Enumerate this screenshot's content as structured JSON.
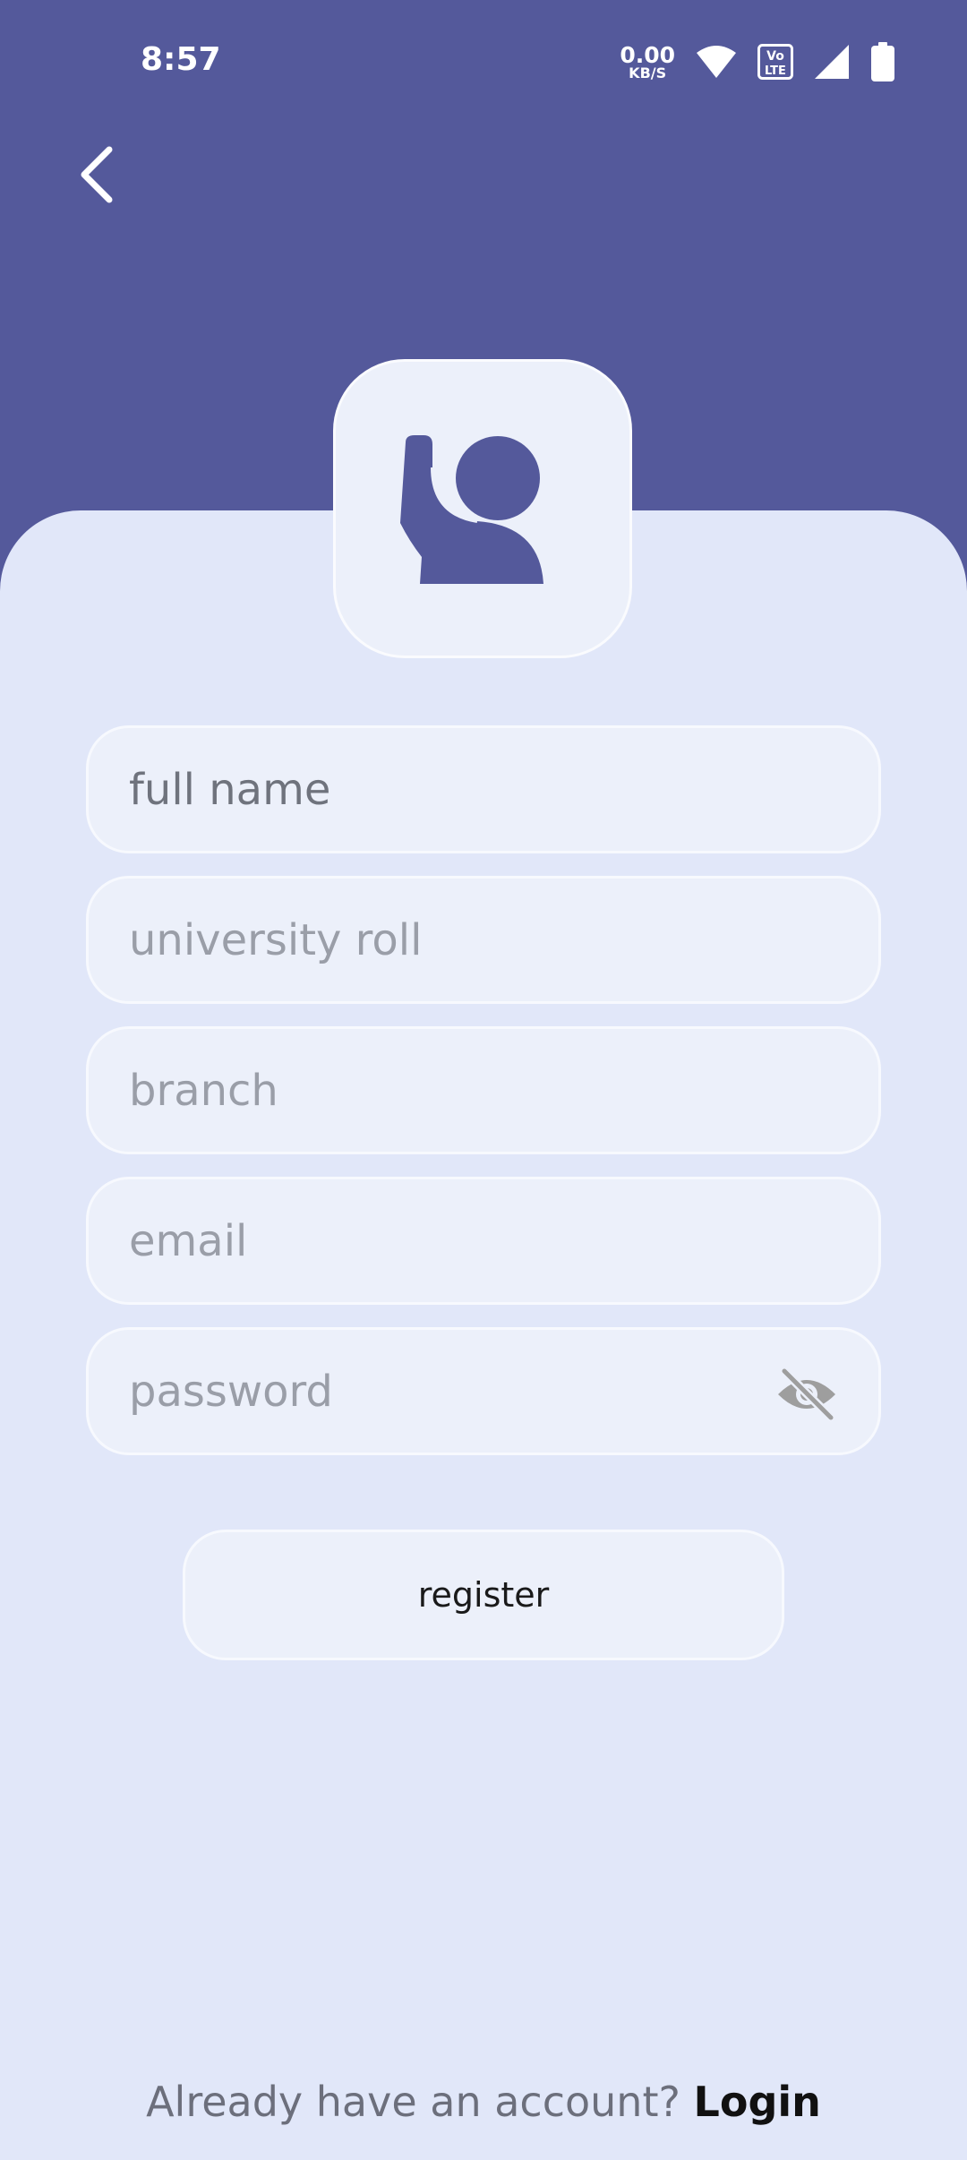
{
  "status_bar": {
    "time": "8:57",
    "net_speed_value": "0.00",
    "net_speed_unit": "KB/S",
    "volte_label_top": "Vo",
    "volte_label_bottom": "LTE"
  },
  "form": {
    "full_name_placeholder": "full name",
    "university_roll_placeholder": "university roll",
    "branch_placeholder": "branch",
    "email_placeholder": "email",
    "password_placeholder": "password"
  },
  "register_button": {
    "label": "register"
  },
  "footer": {
    "prompt": "Already have an account?",
    "login_link": "Login"
  },
  "colors": {
    "header": "#54599B",
    "background": "#E1E7F9",
    "field": "#ECF0FA",
    "icon": "#54599B"
  }
}
